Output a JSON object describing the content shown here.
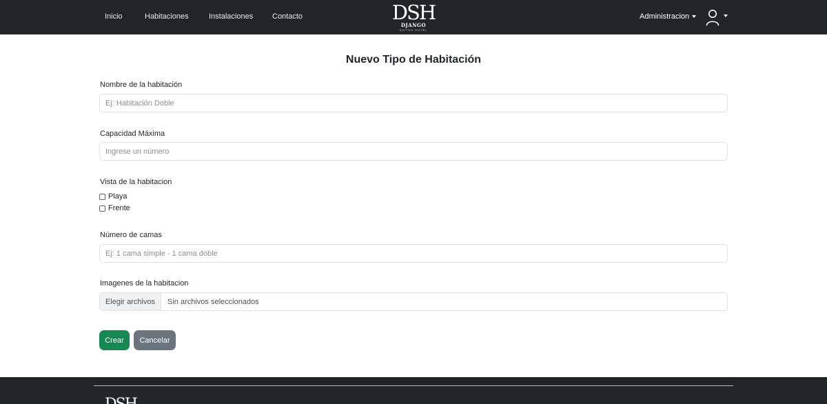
{
  "nav": {
    "links": [
      "Inicio",
      "Habitaciones",
      "Instalaciones",
      "Contacto"
    ],
    "brand": {
      "main": "DSH",
      "sub": "DJANGO",
      "tagline": "SUITES HOTEL"
    },
    "admin_label": "Administracion",
    "user_icon": "user-outline-icon"
  },
  "form": {
    "title": "Nuevo Tipo de Habitación",
    "name_label": "Nombre de la habitación",
    "name_placeholder": "Ej: Habitación Doble",
    "capacity_label": "Capacidad Máxima",
    "capacity_placeholder": "Ingrese un número",
    "view_label": "Vista de la habitacion",
    "view_options": [
      "Playa",
      "Frente"
    ],
    "beds_label": "Número de camas",
    "beds_placeholder": "Ej: 1 cama simple - 1 cama doble",
    "images_label": "Imagenes de la habitacion",
    "file_button": "Elegir archivos",
    "file_status": "Sin archivos seleccionados",
    "create_button": "Crear",
    "cancel_button": "Cancelar"
  },
  "footer": {
    "logo": "DSH"
  },
  "colors": {
    "navbar": "#212529",
    "create": "#198754",
    "cancel": "#6c757d",
    "input_border": "#dee2e6"
  }
}
